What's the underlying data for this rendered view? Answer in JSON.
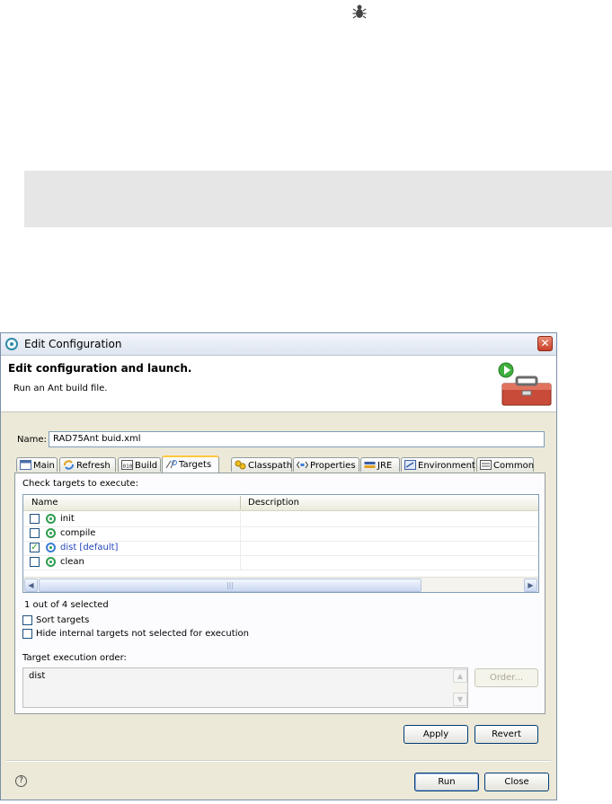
{
  "dialog": {
    "title": "Edit Configuration",
    "close_glyph": "✕",
    "header_title": "Edit configuration and launch.",
    "header_subtitle": "Run an Ant build file."
  },
  "name_field": {
    "label": "Name:",
    "value": "RAD75Ant buid.xml"
  },
  "tabs": [
    {
      "label": "Main",
      "icon": "main-tab-icon"
    },
    {
      "label": "Refresh",
      "icon": "refresh-icon"
    },
    {
      "label": "Build",
      "icon": "build-icon"
    },
    {
      "label": "Targets",
      "icon": "targets-icon",
      "active": true
    },
    {
      "label": "Classpath",
      "icon": "classpath-icon"
    },
    {
      "label": "Properties",
      "icon": "properties-icon"
    },
    {
      "label": "JRE",
      "icon": "jre-icon"
    },
    {
      "label": "Environment",
      "icon": "environment-icon"
    },
    {
      "label": "Common",
      "icon": "common-icon"
    }
  ],
  "targets": {
    "check_label": "Check targets to execute:",
    "columns": [
      "Name",
      "Description"
    ],
    "rows": [
      {
        "name": "init",
        "checked": false
      },
      {
        "name": "compile",
        "checked": false
      },
      {
        "name": "dist [default]",
        "checked": true
      },
      {
        "name": "clean",
        "checked": false
      }
    ],
    "check_glyph": "✓",
    "scroll_left": "◀",
    "scroll_right": "▶",
    "scroll_grip": "|||",
    "selected_count": "1 out of 4 selected",
    "sort_label": "Sort targets",
    "hide_label": "Hide internal targets not selected for execution",
    "order_label": "Target execution order:",
    "order_value": "dist",
    "order_button": "Order...",
    "scroll_up": "▲",
    "scroll_down": "▼"
  },
  "buttons": {
    "apply": "Apply",
    "revert": "Revert",
    "run": "Run",
    "close": "Close",
    "help": "?"
  }
}
